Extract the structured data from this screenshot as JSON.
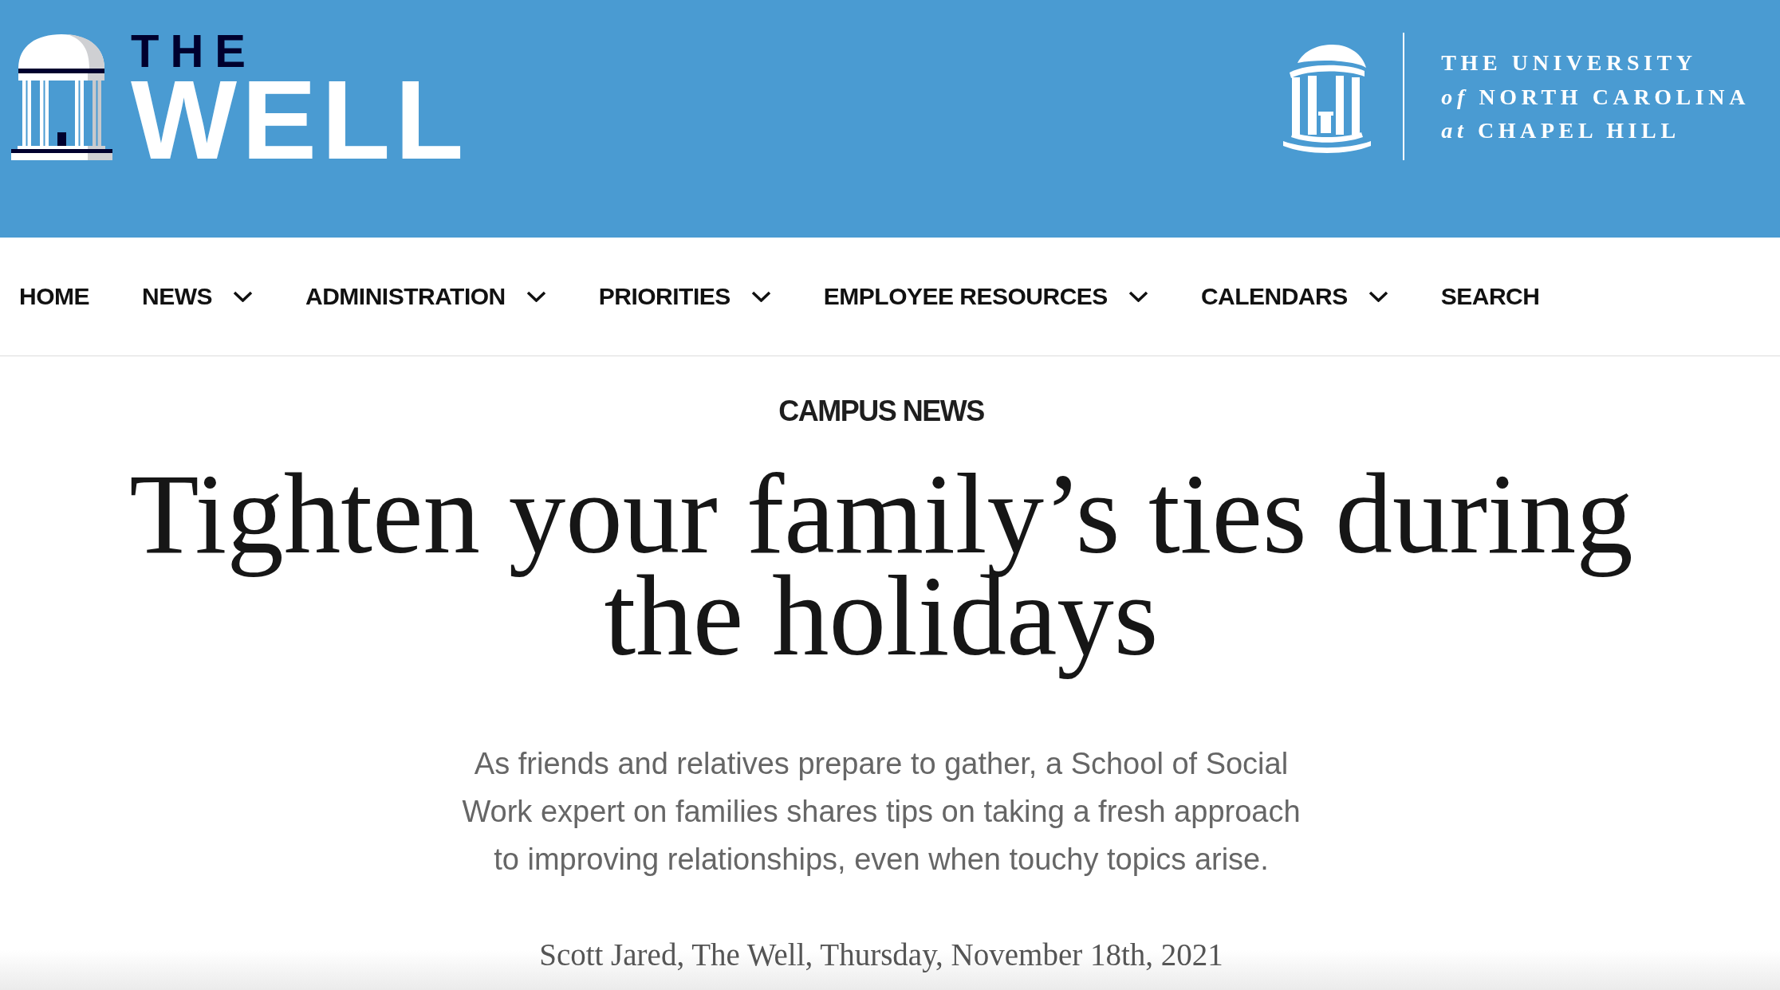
{
  "header": {
    "site_logo": {
      "small_word": "THE",
      "large_word": "WELL"
    },
    "university_logo": {
      "lines": [
        "THE UNIVERSITY",
        "*of* NORTH CAROLINA",
        "*at* CHAPEL HILL"
      ]
    }
  },
  "nav": [
    {
      "label": "HOME",
      "kind": "link"
    },
    {
      "label": "NEWS",
      "kind": "dropdown"
    },
    {
      "label": "ADMINISTRATION",
      "kind": "dropdown"
    },
    {
      "label": "PRIORITIES",
      "kind": "dropdown"
    },
    {
      "label": "EMPLOYEE RESOURCES",
      "kind": "dropdown"
    },
    {
      "label": "CALENDARS",
      "kind": "dropdown"
    },
    {
      "label": "SEARCH",
      "kind": "link"
    }
  ],
  "article": {
    "category": "CAMPUS NEWS",
    "title": "Tighten your family’s ties during the holidays",
    "summary": "As friends and relatives prepare to gather, a School of Social Work expert on families shares tips on taking a fresh approach to improving relationships, even when touchy topics arise.",
    "byline": "Scott Jared, The Well, Thursday, November 18th, 2021"
  }
}
